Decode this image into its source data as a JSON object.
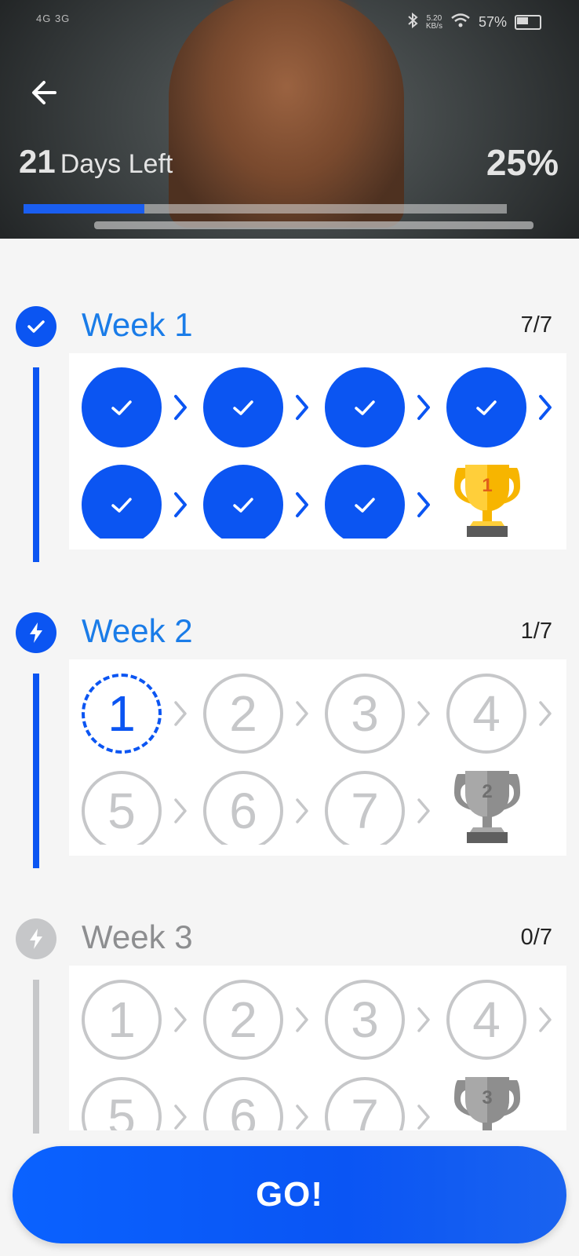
{
  "status_bar": {
    "network": "4G  3G",
    "speed_value": "5.20",
    "speed_unit": "KB/s",
    "battery": "57%"
  },
  "hero": {
    "days_number": "21",
    "days_label": "Days Left",
    "percent_text": "25%",
    "progress": 0.25
  },
  "colors": {
    "accent": "#0b55f2",
    "inactive": "#c6c7c9",
    "trophy_gold": "#f7b500",
    "trophy_silver": "#8e8e8e"
  },
  "weeks": [
    {
      "title": "Week 1",
      "count": "7/7",
      "state": "completed",
      "trophy_number": "1",
      "days": [
        "",
        "",
        "",
        "",
        "",
        "",
        ""
      ]
    },
    {
      "title": "Week 2",
      "count": "1/7",
      "state": "current",
      "trophy_number": "2",
      "days": [
        "1",
        "2",
        "3",
        "4",
        "5",
        "6",
        "7"
      ]
    },
    {
      "title": "Week 3",
      "count": "0/7",
      "state": "locked",
      "trophy_number": "3",
      "days": [
        "1",
        "2",
        "3",
        "4",
        "5",
        "6",
        "7"
      ]
    }
  ],
  "go_button": "GO!"
}
